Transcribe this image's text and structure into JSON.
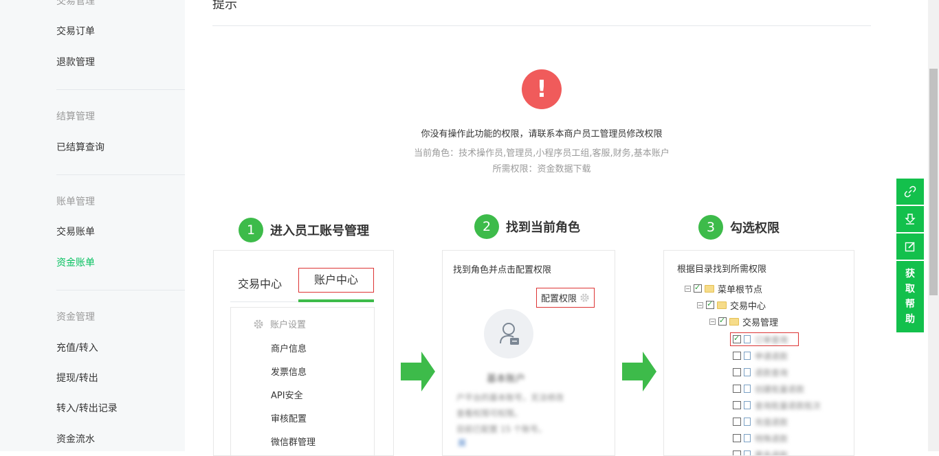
{
  "sidebar": {
    "groups": [
      {
        "title": "交易管理",
        "items": [
          "交易订单",
          "退款管理"
        ]
      },
      {
        "title": "结算管理",
        "items": [
          "已结算查询"
        ]
      },
      {
        "title": "账单管理",
        "items": [
          "交易账单",
          "资金账单"
        ]
      },
      {
        "title": "资金管理",
        "items": [
          "充值/转入",
          "提现/转出",
          "转入/转出记录",
          "资金流水"
        ]
      }
    ],
    "active_item": "资金账单"
  },
  "main": {
    "title": "提示",
    "message": "你没有操作此功能的权限，请联系本商户员工管理员修改权限",
    "current_role": "当前角色：技术操作员,管理员,小程序员工组,客服,财务,基本账户",
    "required_permission": "所需权限：资金数据下载"
  },
  "steps": [
    {
      "num": "1",
      "title": "进入员工账号管理"
    },
    {
      "num": "2",
      "title": "找到当前角色"
    },
    {
      "num": "3",
      "title": "勾选权限"
    }
  ],
  "step1": {
    "tab_trade": "交易中心",
    "tab_account": "账户中心",
    "menu_header": "账户设置",
    "menu_items": [
      "商户信息",
      "发票信息",
      "API安全",
      "审核配置",
      "微信群管理"
    ]
  },
  "step2": {
    "hint": "找到角色并点击配置权限",
    "config_button": "配置权限",
    "role_name": "基本账户",
    "desc_line1": "户平台的基本账号，无法修改",
    "desc_line2": "查看权限可权限。",
    "desc_line3": "目前已配置 15 个账号。",
    "desc_link": "展"
  },
  "step3": {
    "hint": "根据目录找到所需权限",
    "root": "菜单根节点",
    "level1": "交易中心",
    "level2": "交易管理",
    "leaves": [
      "订单查询",
      "申请退款",
      "退款查询",
      "创建批量退款",
      "查询批量退款批次",
      "充值退款",
      "特殊退款",
      "更多退款"
    ]
  },
  "float_bar": {
    "help_chars": [
      "获",
      "取",
      "帮",
      "助"
    ]
  },
  "colors": {
    "accent_green": "#07c160",
    "step_green": "#3dbb4a",
    "warning_red": "#f05b5b",
    "float_green": "#13c04c"
  }
}
